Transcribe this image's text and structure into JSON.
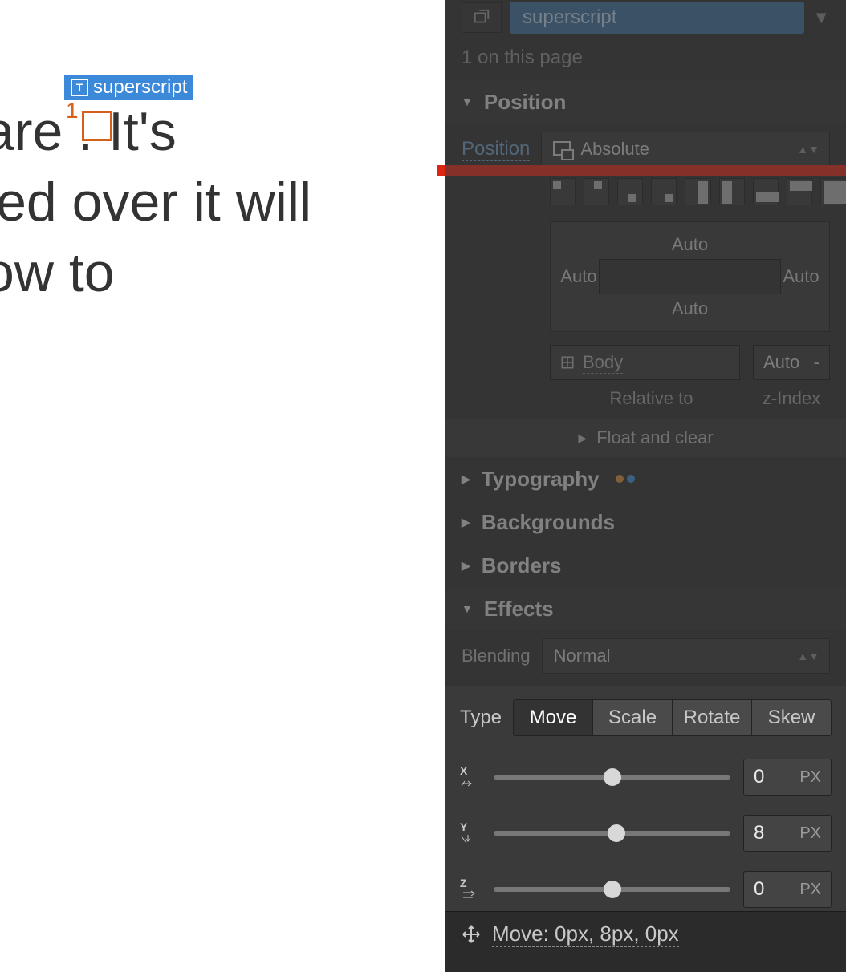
{
  "canvas": {
    "line1": "are    . It's",
    "line2": "led over it will",
    "line3": "ow to",
    "superscript": "1",
    "selection_label": "superscript"
  },
  "selector": {
    "class_name": "superscript",
    "count_text": "1 on this page"
  },
  "position": {
    "header": "Position",
    "label": "Position",
    "value": "Absolute",
    "box": {
      "top": "Auto",
      "left": "Auto",
      "right": "Auto",
      "bottom": "Auto"
    },
    "relative_to": "Body",
    "relative_to_label": "Relative to",
    "zindex_value": "Auto",
    "zindex_dash": "-",
    "zindex_label": "z-Index",
    "float_label": "Float and clear"
  },
  "sections": {
    "typography": "Typography",
    "backgrounds": "Backgrounds",
    "borders": "Borders",
    "effects": "Effects"
  },
  "blending": {
    "label": "Blending",
    "value": "Normal"
  },
  "transform": {
    "type_label": "Type",
    "tabs": [
      "Move",
      "Scale",
      "Rotate",
      "Skew"
    ],
    "active_tab": "Move",
    "axes": [
      {
        "axis": "X",
        "value": "0",
        "unit": "PX",
        "pos": 50
      },
      {
        "axis": "Y",
        "value": "8",
        "unit": "PX",
        "pos": 52
      },
      {
        "axis": "Z",
        "value": "0",
        "unit": "PX",
        "pos": 50
      }
    ],
    "summary": "Move: 0px, 8px, 0px"
  }
}
